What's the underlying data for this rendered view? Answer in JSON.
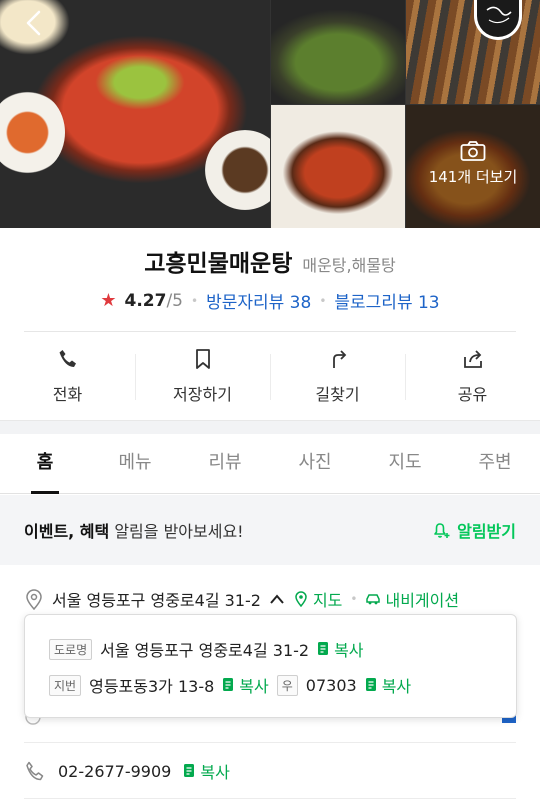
{
  "photos": {
    "more_label": "141개 더보기"
  },
  "place": {
    "name": "고흥민물매운탕",
    "category": "매운탕,해물탕",
    "rating": "4.27",
    "rating_scale": "/5",
    "visitor_reviews": "방문자리뷰 38",
    "blog_reviews": "블로그리뷰 13"
  },
  "actions": {
    "call": "전화",
    "save": "저장하기",
    "directions": "길찾기",
    "share": "공유"
  },
  "tabs": [
    "홈",
    "메뉴",
    "리뷰",
    "사진",
    "지도",
    "주변"
  ],
  "event": {
    "bold": "이벤트, 혜택",
    "text": " 알림을 받아보세요!",
    "button": "알림받기"
  },
  "address": {
    "main": "서울 영등포구 영중로4길 31-2",
    "map": "지도",
    "navigation": "내비게이션",
    "road_tag": "도로명",
    "road": "서울 영등포구 영중로4길 31-2",
    "lot_tag": "지번",
    "lot": "영등포동3가 13-8",
    "zip_tag": "우",
    "zip": "07303",
    "copy": "복사"
  },
  "phone": {
    "number": "02-2677-9909",
    "copy": "복사"
  },
  "colors": {
    "naver_green": "#03c75a",
    "link_blue": "#1e64c8",
    "star_red": "#e03a3e"
  }
}
